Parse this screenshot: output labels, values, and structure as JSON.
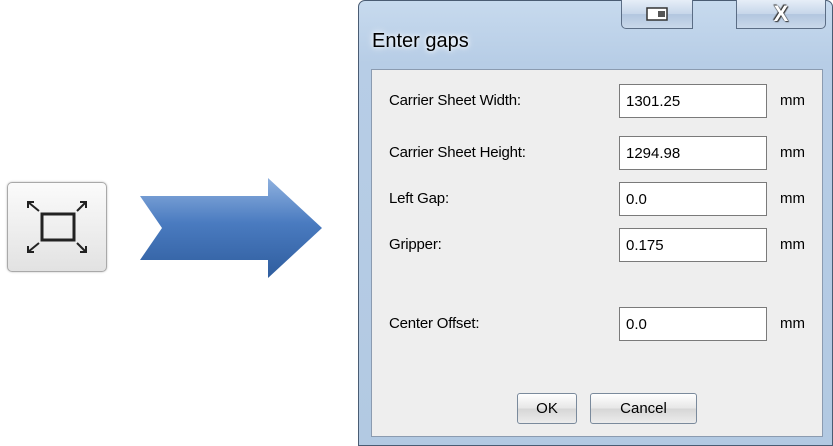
{
  "toolbar_icon": {
    "icon": "fit-to-frame-icon"
  },
  "arrow": {
    "icon": "right-arrow-icon",
    "color": "#4a7bc0"
  },
  "dialog": {
    "title": "Enter gaps",
    "caption_buttons": {
      "restore_icon": "restore-icon",
      "close_label": "X"
    },
    "fields": [
      {
        "label": "Carrier Sheet Width:",
        "value": "1301.25",
        "unit": "mm"
      },
      {
        "label": "Carrier Sheet Height:",
        "value": "1294.98",
        "unit": "mm"
      },
      {
        "label": "Left Gap:",
        "value": "0.0",
        "unit": "mm"
      },
      {
        "label": "Gripper:",
        "value": "0.175",
        "unit": "mm"
      },
      {
        "label": "Center Offset:",
        "value": "0.0",
        "unit": "mm"
      }
    ],
    "ok_label": "OK",
    "cancel_label": "Cancel"
  },
  "colors": {
    "frame": "#b7cde6",
    "client": "#eeeeee",
    "arrow": "#4a7bc0"
  }
}
